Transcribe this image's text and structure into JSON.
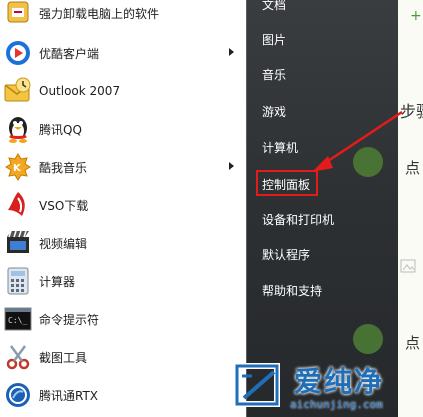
{
  "programs": [
    {
      "label": "强力卸载电脑上的软件",
      "icon": "uninstall-icon",
      "arrow": false
    },
    {
      "label": "优酷客户端",
      "icon": "youku-icon",
      "arrow": true
    },
    {
      "label": "Outlook 2007",
      "icon": "outlook-icon",
      "arrow": false
    },
    {
      "label": "腾讯QQ",
      "icon": "qq-penguin-icon",
      "arrow": false
    },
    {
      "label": "酷我音乐",
      "icon": "kuwo-music-icon",
      "arrow": true
    },
    {
      "label": "VSO下载",
      "icon": "vso-download-icon",
      "arrow": false
    },
    {
      "label": "视频编辑",
      "icon": "video-edit-icon",
      "arrow": false
    },
    {
      "label": "计算器",
      "icon": "calculator-icon",
      "arrow": false
    },
    {
      "label": "命令提示符",
      "icon": "command-prompt-icon",
      "arrow": false
    },
    {
      "label": "截图工具",
      "icon": "snipping-tool-icon",
      "arrow": false
    },
    {
      "label": "腾讯通RTX",
      "icon": "rtx-icon",
      "arrow": false
    }
  ],
  "right_menu": [
    {
      "label": "文档"
    },
    {
      "label": "图片"
    },
    {
      "label": "音乐"
    },
    {
      "label": "游戏"
    },
    {
      "label": "计算机"
    },
    {
      "label": "控制面板"
    },
    {
      "label": "设备和打印机"
    },
    {
      "label": "默认程序"
    },
    {
      "label": "帮助和支持"
    }
  ],
  "background_text": {
    "plus": "+",
    "step": "步骤",
    "dian1": "点",
    "dian2": "点"
  },
  "watermark": {
    "brand": "爱纯净",
    "url": "aichunjing.com"
  },
  "colors": {
    "highlight": "#e21b1b",
    "arrow": "#e21b1b",
    "watermark_blue": "#1f6fb8"
  }
}
